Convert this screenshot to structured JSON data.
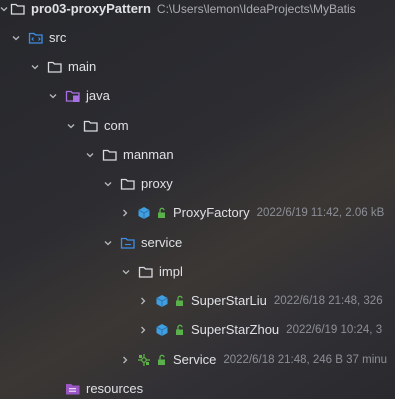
{
  "project": {
    "name": "pro03-proxyPattern",
    "path": "C:\\Users\\lemon\\IdeaProjects\\MyBatis"
  },
  "nodes": {
    "src": {
      "label": "src",
      "icon": "source-folder-icon"
    },
    "main": {
      "label": "main",
      "icon": "folder-icon"
    },
    "java": {
      "label": "java",
      "icon": "java-source-root-icon"
    },
    "com": {
      "label": "com",
      "icon": "package-icon"
    },
    "manman": {
      "label": "manman",
      "icon": "package-icon"
    },
    "proxy": {
      "label": "proxy",
      "icon": "package-icon"
    },
    "proxyfactory": {
      "label": "ProxyFactory",
      "meta": "2022/6/19 11:42, 2.06 kB",
      "icon": "class-icon"
    },
    "service": {
      "label": "service",
      "icon": "package-icon"
    },
    "impl": {
      "label": "impl",
      "icon": "package-icon"
    },
    "superstarliu": {
      "label": "SuperStarLiu",
      "meta": "2022/6/18 21:48, 326",
      "icon": "class-icon"
    },
    "superstarzhou": {
      "label": "SuperStarZhou",
      "meta": "2022/6/19 10:24, 3",
      "icon": "class-icon"
    },
    "serviceiface": {
      "label": "Service",
      "meta": "2022/6/18 21:48, 246 B 37 minu",
      "icon": "interface-icon"
    },
    "resources": {
      "label": "resources",
      "icon": "resources-folder-icon"
    }
  },
  "colors": {
    "folder_outline": "#d9dbe0",
    "source_blue": "#3d8ee6",
    "java_purple": "#a970e3",
    "class_blue": "#3f9fe0",
    "access_green": "#5ab04b",
    "interface_green": "#5fb548",
    "resources_purple": "#9a57c4",
    "chevron": "#b7b9be",
    "meta_gray": "#8c8f96"
  }
}
